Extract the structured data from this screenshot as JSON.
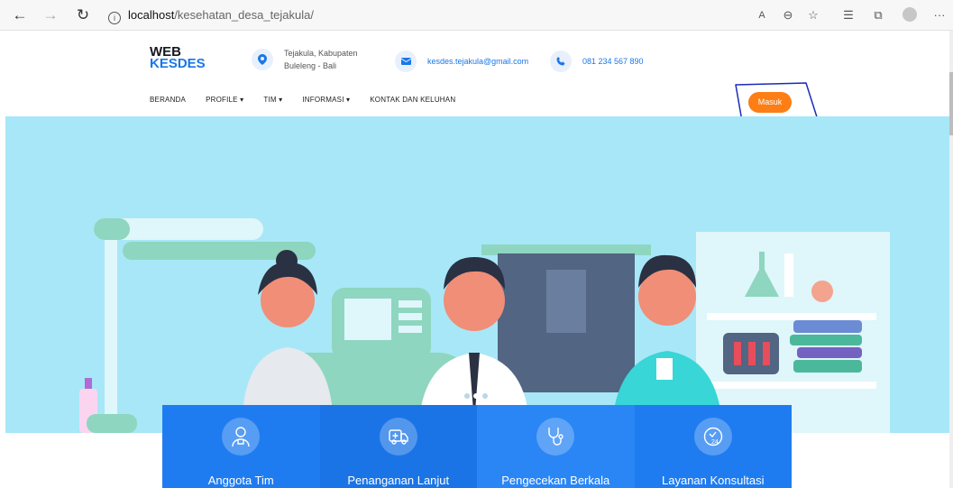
{
  "browser": {
    "url_host": "localhost",
    "url_path": "/kesehatan_desa_tejakula/"
  },
  "site": {
    "logo_line1": "WEB",
    "logo_line2": "KESDES",
    "address_line1": "Tejakula, Kabupaten",
    "address_line2": "Buleleng - Bali",
    "email": "kesdes.tejakula@gmail.com",
    "phone": "081 234 567 890"
  },
  "nav": {
    "items": [
      {
        "label": "BERANDA"
      },
      {
        "label": "PROFILE ▾"
      },
      {
        "label": "TIM ▾"
      },
      {
        "label": "INFORMASI ▾"
      },
      {
        "label": "KONTAK DAN KELUHAN"
      }
    ],
    "login_label": "Masuk"
  },
  "services": [
    {
      "label": "Anggota Tim",
      "icon": "doctor-icon",
      "color": "#1f7cf0"
    },
    {
      "label": "Penanganan Lanjut",
      "icon": "ambulance-icon",
      "color": "#1a74e6"
    },
    {
      "label": "Pengecekan Berkala",
      "icon": "stethoscope-icon",
      "color": "#2a86f5"
    },
    {
      "label": "Layanan Konsultasi",
      "icon": "clock-24-icon",
      "color": "#1f7cf0"
    }
  ],
  "colors": {
    "brand_blue": "#1a77e8",
    "accent_orange": "#fd7e14",
    "hero_bg": "#a8e7f7"
  }
}
